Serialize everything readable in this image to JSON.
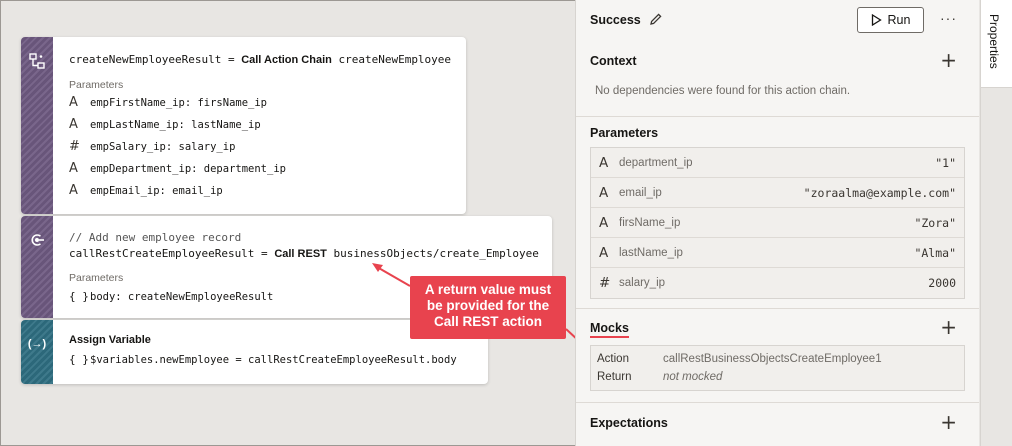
{
  "canvas": {
    "card1": {
      "code_prefix": "createNewEmployeeResult = ",
      "keyword": "Call Action Chain",
      "target": " createNewEmployee",
      "params_label": "Parameters",
      "params": [
        {
          "type_icon": "A",
          "text": "empFirstName_ip: firsName_ip"
        },
        {
          "type_icon": "A",
          "text": "empLastName_ip: lastName_ip"
        },
        {
          "type_icon": "#",
          "text": "empSalary_ip: salary_ip"
        },
        {
          "type_icon": "A",
          "text": "empDepartment_ip: department_ip"
        },
        {
          "type_icon": "A",
          "text": "empEmail_ip: email_ip"
        }
      ]
    },
    "card2": {
      "comment": "// Add new employee record",
      "code_prefix": "callRestCreateEmployeeResult = ",
      "keyword": "Call REST",
      "target": " businessObjects/create_Employee",
      "params_label": "Parameters",
      "param_icon": "{ }",
      "param_text": "body: createNewEmployeeResult"
    },
    "card3": {
      "title": "Assign Variable",
      "icon_glyph": "(→)",
      "param_icon": "{ }",
      "param_text": "$variables.newEmployee = callRestCreateEmployeeResult.body"
    },
    "callout": {
      "line1": "A return value must",
      "line2": "be provided for the",
      "line3": "Call REST action",
      "color": "#e8434e"
    }
  },
  "panel": {
    "title": "Success",
    "run_label": "Run",
    "more_label": "···",
    "context": {
      "title": "Context",
      "message": "No dependencies were found for this action chain."
    },
    "parameters": {
      "title": "Parameters",
      "rows": [
        {
          "type_icon": "A",
          "name": "department_ip",
          "value": "\"1\""
        },
        {
          "type_icon": "A",
          "name": "email_ip",
          "value": "\"zoraalma@example.com\""
        },
        {
          "type_icon": "A",
          "name": "firsName_ip",
          "value": "\"Zora\""
        },
        {
          "type_icon": "A",
          "name": "lastName_ip",
          "value": "\"Alma\""
        },
        {
          "type_icon": "#",
          "name": "salary_ip",
          "value": "2000"
        }
      ]
    },
    "mocks": {
      "title": "Mocks",
      "action_label": "Action",
      "action_value": "callRestBusinessObjectsCreateEmployee1",
      "return_label": "Return",
      "return_value": "not mocked"
    },
    "expectations": {
      "title": "Expectations"
    },
    "add_label": "+"
  },
  "side_tab": {
    "label": "Properties"
  }
}
